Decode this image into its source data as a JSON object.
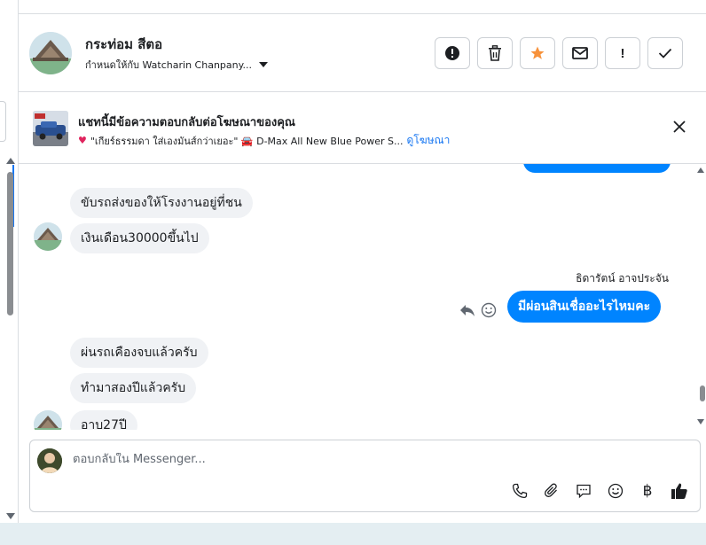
{
  "header": {
    "contact_name": "กระท่อม สีตอ",
    "assigned_to": "กำหนดให้กับ Watcharin Chanpany..."
  },
  "actions": [
    {
      "name": "report-icon",
      "glyph": "!"
    },
    {
      "name": "trash-icon",
      "glyph": ""
    },
    {
      "name": "star-icon",
      "glyph": ""
    },
    {
      "name": "mail-icon",
      "glyph": ""
    },
    {
      "name": "exclamation-icon",
      "glyph": "!"
    },
    {
      "name": "check-icon",
      "glyph": ""
    }
  ],
  "ad_banner": {
    "title": "แชทนี้มีข้อความตอบกลับต่อโฆษณาของคุณ",
    "ad_text": "\"เกียร์ธรรมดา ใส่เองมันส์กว่าเยอะ\" 🚘 D-Max All New Blue Power S...",
    "link": "ดูโฆษณา"
  },
  "messages": {
    "in_1": "ขับรถส่งของให้โรงงานอยู่ที่ชน",
    "in_2": "เงินเดือน30000ขึ้นไป",
    "sender_name": "ธิดารัตน์ อาจประจัน",
    "out_1": "มีผ่อนสินเชื่ออะไรไหมคะ",
    "in_3": "ผ่นรถเคืองจบแล้วครับ",
    "in_4": "ทำมาสองปีแล้วครับ",
    "in_5": "อาบ27ปี"
  },
  "composer": {
    "placeholder": "ตอบกลับใน Messenger...",
    "baht_symbol": "฿"
  },
  "colors": {
    "accent": "#0084ff",
    "star": "#f7923b",
    "link": "#1877f2"
  }
}
